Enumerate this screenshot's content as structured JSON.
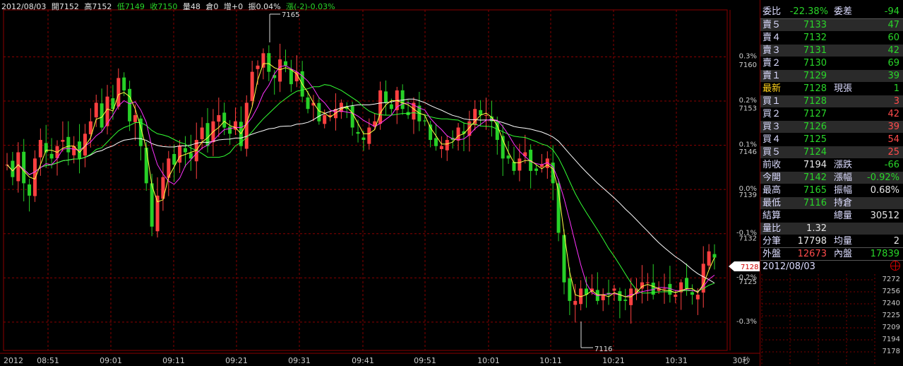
{
  "header": {
    "date": "2012/08/03",
    "open": "開7152",
    "high": "高7152",
    "low": "低7149",
    "close": "收7150",
    "volume": "量48",
    "oi": "倉0",
    "oi_change": "增+0",
    "amplitude": "振0.04%",
    "change": "漲(-2)-0.03%"
  },
  "chart_data": {
    "type": "line",
    "title": "",
    "x_labels": [
      "2012",
      "08:51",
      "09:01",
      "09:11",
      "09:21",
      "09:31",
      "09:41",
      "09:51",
      "10:01",
      "10:11",
      "10:21",
      "10:31",
      "30秒"
    ],
    "y_ticks": [
      7160,
      7153,
      7146,
      7139,
      7132,
      7125
    ],
    "pct_ticks": [
      "0.3%",
      "0.2%",
      "0.1%",
      "0.0%",
      "-0.1%",
      "-0.2%",
      "-0.3%"
    ],
    "ylim": [
      7113,
      7168
    ],
    "prev_close": 7139,
    "high_annotation": "7165",
    "low_annotation": "7116",
    "current_price_tag": "7128",
    "price": [
      7143,
      7141,
      7145,
      7140,
      7138,
      7144,
      7147,
      7145,
      7144,
      7146,
      7147,
      7145,
      7146,
      7144,
      7148,
      7150,
      7153,
      7149,
      7154,
      7152,
      7157,
      7155,
      7150,
      7151,
      7146,
      7140,
      7133,
      7138,
      7141,
      7144,
      7143,
      7146,
      7145,
      7144,
      7147,
      7149,
      7146,
      7150,
      7151,
      7149,
      7148,
      7150,
      7146,
      7153,
      7158,
      7159,
      7161,
      7158,
      7157,
      7160,
      7159,
      7156,
      7158,
      7154,
      7152,
      7153,
      7150,
      7151,
      7151,
      7152,
      7153,
      7152,
      7149,
      7148,
      7147,
      7149,
      7150,
      7155,
      7153,
      7152,
      7155,
      7152,
      7151,
      7153,
      7150,
      7150,
      7147,
      7146,
      7146,
      7147,
      7147,
      7149,
      7148,
      7150,
      7152,
      7151,
      7151,
      7150,
      7147,
      7144,
      7144,
      7142,
      7144,
      7145,
      7142,
      7142,
      7143,
      7144,
      7140,
      7132,
      7124,
      7121,
      7121,
      7123,
      7122,
      7123,
      7121,
      7122,
      7122,
      7123,
      7121,
      7121,
      7123,
      7123,
      7124,
      7124,
      7122,
      7123,
      7123,
      7122,
      7122,
      7124,
      7123,
      7122,
      7122,
      7127,
      7129,
      7128
    ],
    "series": [
      {
        "name": "",
        "color": "#ffffff",
        "period": 60
      },
      {
        "name": "",
        "color": "#33ff33",
        "period": 30
      },
      {
        "name": "",
        "color": "#ff33ff",
        "period": 12
      },
      {
        "name": "",
        "color": "#ffff44",
        "period": 5
      }
    ],
    "colors": {
      "up": "#ff4040",
      "down": "#27d027",
      "grid": "#8a0000"
    },
    "volume_panel_ticks": [
      7272,
      7256,
      7240,
      7225,
      7209,
      7194,
      7178
    ],
    "volume_panel_date": "2012/08/03"
  },
  "quote": {
    "ratio_label": "委比",
    "ratio_value": "-22.38%",
    "diff_label": "委差",
    "diff_value": "-94",
    "asks": [
      {
        "label": "賣５",
        "price": "7133",
        "qty": "47"
      },
      {
        "label": "賣４",
        "price": "7132",
        "qty": "60"
      },
      {
        "label": "賣３",
        "price": "7131",
        "qty": "42"
      },
      {
        "label": "賣２",
        "price": "7130",
        "qty": "69"
      },
      {
        "label": "賣１",
        "price": "7129",
        "qty": "39"
      }
    ],
    "last_label": "最新",
    "last_price": "7128",
    "now_qty_label": "現張",
    "now_qty": "1",
    "bids": [
      {
        "label": "買１",
        "price": "7128",
        "qty": "3"
      },
      {
        "label": "買２",
        "price": "7127",
        "qty": "42"
      },
      {
        "label": "買３",
        "price": "7126",
        "qty": "39"
      },
      {
        "label": "買４",
        "price": "7125",
        "qty": "54"
      },
      {
        "label": "買５",
        "price": "7124",
        "qty": "25"
      }
    ],
    "prev_close_label": "前收",
    "prev_close": "7194",
    "change_label": "漲跌",
    "change": "-66",
    "open_label": "今開",
    "open": "7142",
    "change_pct_label": "漲幅",
    "change_pct": "-0.92%",
    "high_label": "最高",
    "high": "7165",
    "amp_label": "振幅",
    "amp": "0.68%",
    "low_label": "最低",
    "low": "7116",
    "oi_label": "持倉",
    "settle_label": "結算",
    "total_vol_label": "總量",
    "total_vol": "30512",
    "vol_ratio_label": "量比",
    "vol_ratio": "1.32",
    "ticks_label": "分筆",
    "ticks": "17798",
    "avg_label": "均量",
    "avg": "2",
    "outer_label": "外盤",
    "outer": "12673",
    "inner_label": "內盤",
    "inner": "17839"
  }
}
